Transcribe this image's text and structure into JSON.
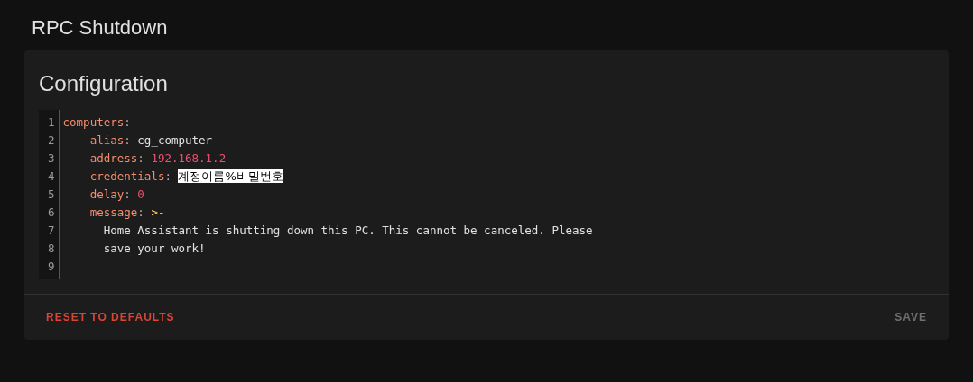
{
  "window": {
    "title": "RPC Shutdown"
  },
  "card": {
    "title": "Configuration",
    "editor": {
      "lines": [
        {
          "number": "1",
          "tokens": [
            {
              "kind": "key",
              "text": "computers"
            },
            {
              "kind": "colon",
              "text": ":"
            }
          ]
        },
        {
          "number": "2",
          "tokens": [
            {
              "kind": "dash",
              "text": "  - "
            },
            {
              "kind": "key",
              "text": "alias"
            },
            {
              "kind": "colon",
              "text": ":"
            },
            {
              "kind": "plain",
              "text": " cg_computer"
            }
          ]
        },
        {
          "number": "3",
          "tokens": [
            {
              "kind": "key",
              "text": "    address"
            },
            {
              "kind": "colon",
              "text": ":"
            },
            {
              "kind": "number",
              "text": " 192.168.1.2"
            }
          ]
        },
        {
          "number": "4",
          "tokens": [
            {
              "kind": "key",
              "text": "    credentials"
            },
            {
              "kind": "colon",
              "text": ": "
            },
            {
              "kind": "highlight",
              "text": "계정이름%비밀번호"
            }
          ]
        },
        {
          "number": "5",
          "tokens": [
            {
              "kind": "key",
              "text": "    delay"
            },
            {
              "kind": "colon",
              "text": ":"
            },
            {
              "kind": "number",
              "text": " 0"
            }
          ]
        },
        {
          "number": "6",
          "tokens": [
            {
              "kind": "key",
              "text": "    message"
            },
            {
              "kind": "colon",
              "text": ":"
            },
            {
              "kind": "block",
              "text": " >-"
            }
          ]
        },
        {
          "number": "7",
          "tokens": [
            {
              "kind": "plain",
              "text": "      Home Assistant is shutting down this PC. This cannot be canceled. Please"
            }
          ]
        },
        {
          "number": "8",
          "tokens": [
            {
              "kind": "plain",
              "text": "      save your work!"
            }
          ]
        },
        {
          "number": "9"
        }
      ]
    },
    "buttons": [
      {
        "label": "RESET TO DEFAULTS",
        "kind": "reset",
        "disabled": false
      },
      {
        "label": "SAVE",
        "kind": "save",
        "disabled": true
      }
    ]
  }
}
